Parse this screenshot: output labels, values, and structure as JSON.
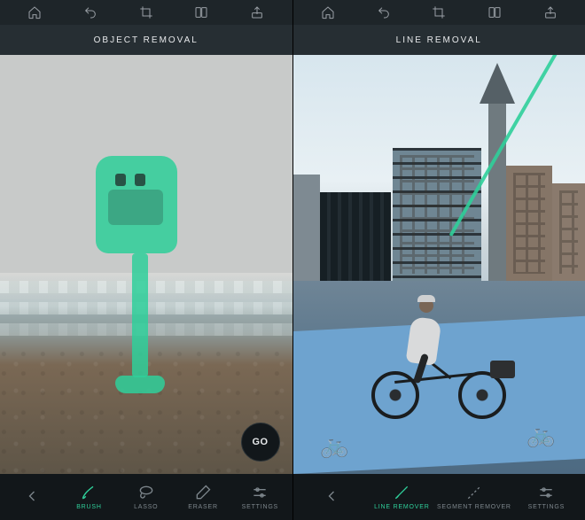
{
  "accent_color": "#2fcf9a",
  "left": {
    "title": "OBJECT REMOVAL",
    "go_label": "GO",
    "topbar_icons": [
      "home-icon",
      "undo-icon",
      "crop-icon",
      "compare-icon",
      "share-icon"
    ],
    "tools": [
      {
        "id": "back",
        "label": ""
      },
      {
        "id": "brush",
        "label": "BRUSH",
        "active": true
      },
      {
        "id": "lasso",
        "label": "LASSO"
      },
      {
        "id": "eraser",
        "label": "ERASER"
      },
      {
        "id": "settings",
        "label": "SETTINGS"
      }
    ]
  },
  "right": {
    "title": "LINE REMOVAL",
    "topbar_icons": [
      "home-icon",
      "undo-icon",
      "crop-icon",
      "compare-icon",
      "share-icon"
    ],
    "tools": [
      {
        "id": "back",
        "label": ""
      },
      {
        "id": "line-remover",
        "label": "LINE REMOVER",
        "active": true
      },
      {
        "id": "segment-remover",
        "label": "SEGMENT REMOVER"
      },
      {
        "id": "settings",
        "label": "SETTINGS"
      }
    ]
  }
}
